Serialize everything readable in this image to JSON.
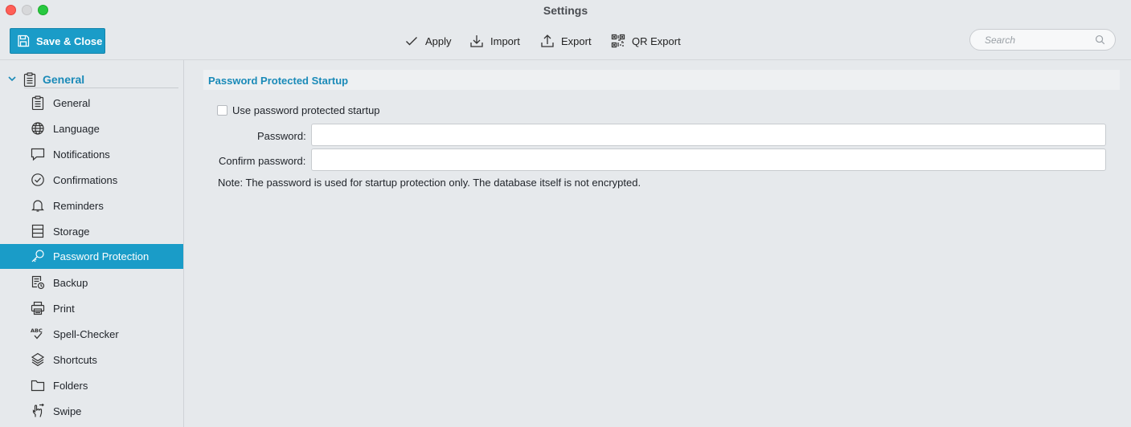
{
  "window": {
    "title": "Settings"
  },
  "toolbar": {
    "save_label": "Save & Close",
    "apply_label": "Apply",
    "import_label": "Import",
    "export_label": "Export",
    "qr_export_label": "QR Export",
    "search_placeholder": "Search"
  },
  "sidebar": {
    "group": {
      "label": "General",
      "icon": "clipboard-icon"
    },
    "items": [
      {
        "label": "General",
        "icon": "clipboard-icon"
      },
      {
        "label": "Language",
        "icon": "globe-icon"
      },
      {
        "label": "Notifications",
        "icon": "speech-bubble-icon"
      },
      {
        "label": "Confirmations",
        "icon": "check-circle-icon"
      },
      {
        "label": "Reminders",
        "icon": "bell-icon"
      },
      {
        "label": "Storage",
        "icon": "storage-icon"
      },
      {
        "label": "Password Protection",
        "icon": "key-icon",
        "active": true
      },
      {
        "label": "Backup",
        "icon": "backup-icon"
      },
      {
        "label": "Print",
        "icon": "printer-icon"
      },
      {
        "label": "Spell-Checker",
        "icon": "spellcheck-icon"
      },
      {
        "label": "Shortcuts",
        "icon": "layers-icon"
      },
      {
        "label": "Folders",
        "icon": "folder-icon"
      },
      {
        "label": "Swipe",
        "icon": "swipe-hand-icon"
      }
    ]
  },
  "main": {
    "section_title": "Password Protected Startup",
    "checkbox_label": "Use password protected startup",
    "checkbox_checked": false,
    "password_label": "Password:",
    "password_value": "",
    "confirm_label": "Confirm password:",
    "confirm_value": "",
    "note": "Note: The password is used for startup protection only. The database itself is not encrypted."
  },
  "colors": {
    "accent": "#1a9cc8",
    "accent_text": "#1a8ab8"
  }
}
